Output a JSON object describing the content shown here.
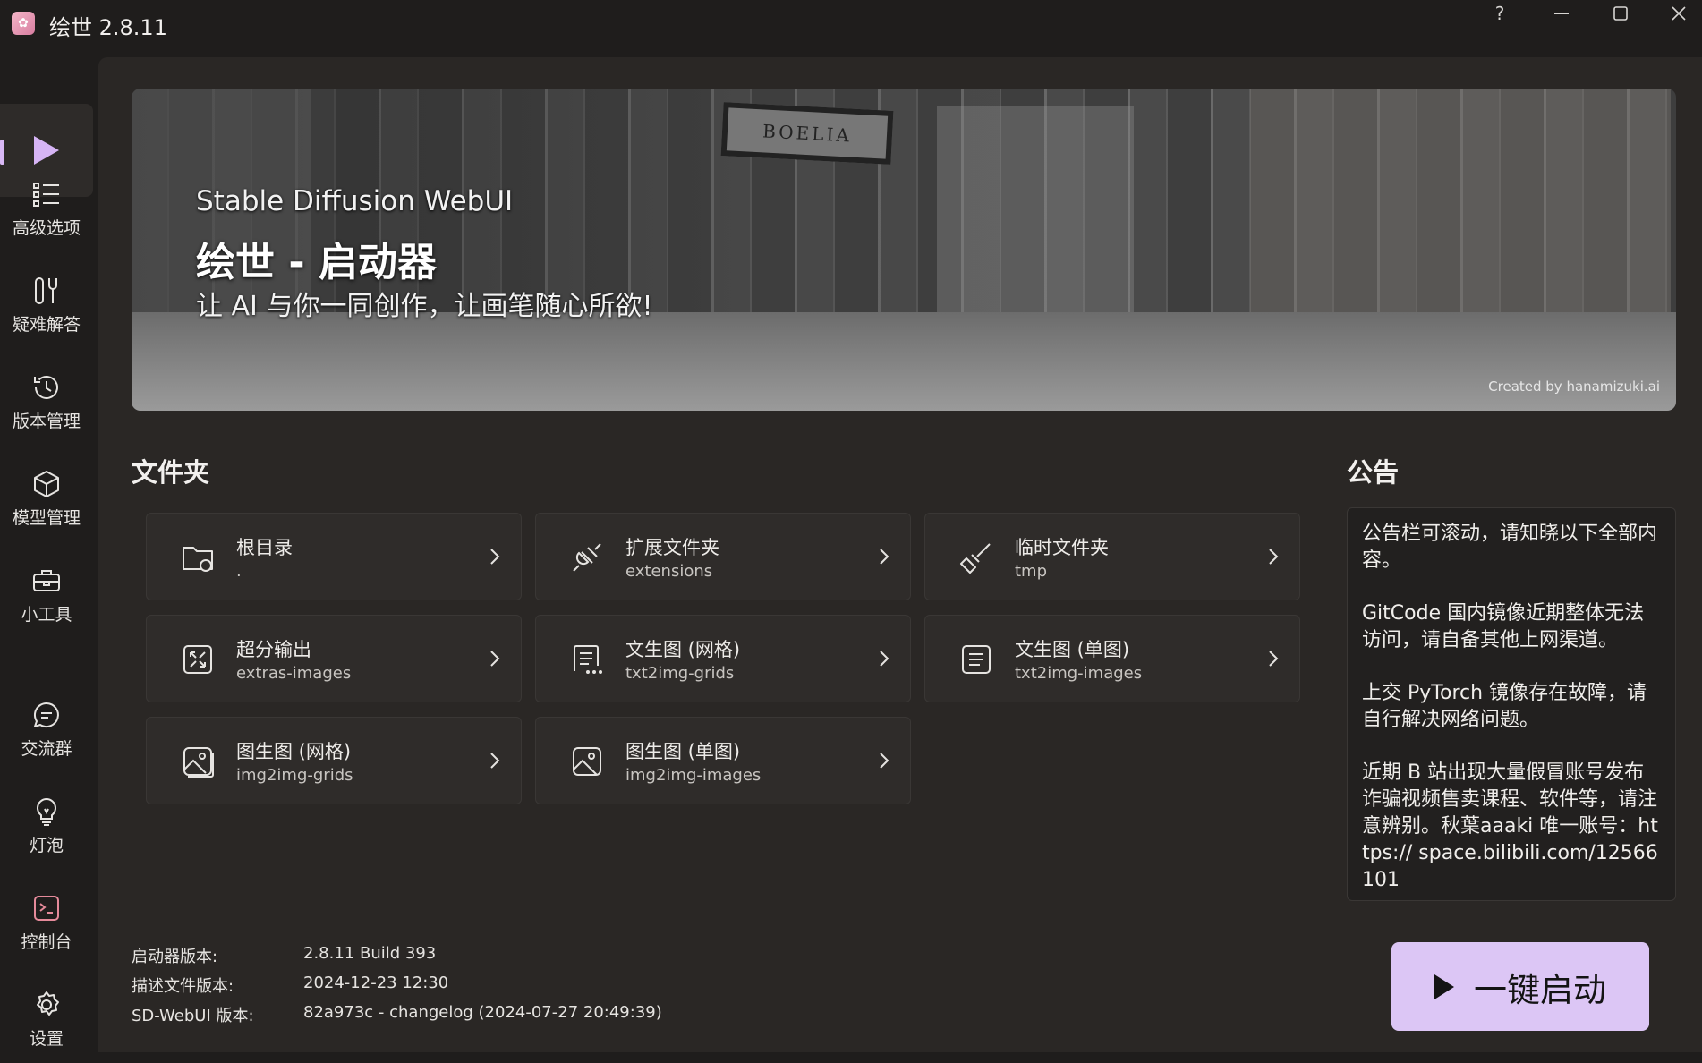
{
  "window": {
    "title": "绘世 2.8.11",
    "controls": {
      "help": "?",
      "minimize": "—",
      "maximize": "☐",
      "close": "✕"
    }
  },
  "sidebar": {
    "items": [
      {
        "label": "高级选项",
        "icon": "list-icon"
      },
      {
        "label": "疑难解答",
        "icon": "wrench-icon"
      },
      {
        "label": "版本管理",
        "icon": "history-icon"
      },
      {
        "label": "模型管理",
        "icon": "cube-icon"
      },
      {
        "label": "小工具",
        "icon": "toolbox-icon"
      },
      {
        "label": "交流群",
        "icon": "chat-icon"
      },
      {
        "label": "灯泡",
        "icon": "lightbulb-icon"
      },
      {
        "label": "控制台",
        "icon": "terminal-icon"
      },
      {
        "label": "设置",
        "icon": "gear-icon"
      }
    ]
  },
  "banner": {
    "subtitle": "Stable Diffusion WebUI",
    "title": "绘世 - 启动器",
    "slogan": "让 AI 与你一同创作，让画笔随心所欲!",
    "credit": "Created by hanamizuki.ai",
    "sign_text": "BOELIA"
  },
  "folders": {
    "title": "文件夹",
    "items": [
      {
        "name": "根目录",
        "path": ".",
        "icon": "folder-icon"
      },
      {
        "name": "扩展文件夹",
        "path": "extensions",
        "icon": "plug-icon"
      },
      {
        "name": "临时文件夹",
        "path": "tmp",
        "icon": "broom-icon"
      },
      {
        "name": "超分输出",
        "path": "extras-images",
        "icon": "upscale-icon"
      },
      {
        "name": "文生图 (网格)",
        "path": "txt2img-grids",
        "icon": "text-grid-icon"
      },
      {
        "name": "文生图 (单图)",
        "path": "txt2img-images",
        "icon": "text-doc-icon"
      },
      {
        "name": "图生图 (网格)",
        "path": "img2img-grids",
        "icon": "image-grid-icon"
      },
      {
        "name": "图生图 (单图)",
        "path": "img2img-images",
        "icon": "image-icon"
      }
    ]
  },
  "notice": {
    "title": "公告",
    "paragraphs": [
      "公告栏可滚动，请知晓以下全部内容。",
      "GitCode 国内镜像近期整体无法访问，请自备其他上网渠道。",
      "上交 PyTorch 镜像存在故障，请自行解决网络问题。",
      "近期 B 站出现大量假冒账号发布诈骗视频售卖课程、软件等，请注意辨别。秋葉aaaki 唯一账号：https:// space.bilibili.com/12566101"
    ]
  },
  "info": {
    "launcher_version_label": "启动器版本:",
    "launcher_version": "2.8.11 Build 393",
    "desc_version_label": "描述文件版本:",
    "desc_version": "2024-12-23 12:30",
    "webui_version_label": "SD-WebUI 版本:",
    "webui_version": "82a973c - changelog (2024-07-27 20:49:39)"
  },
  "launch": {
    "label": "一键启动"
  },
  "colors": {
    "accent": "#dcc6f5",
    "background": "#1f1d1c",
    "panel": "#2a2725"
  }
}
